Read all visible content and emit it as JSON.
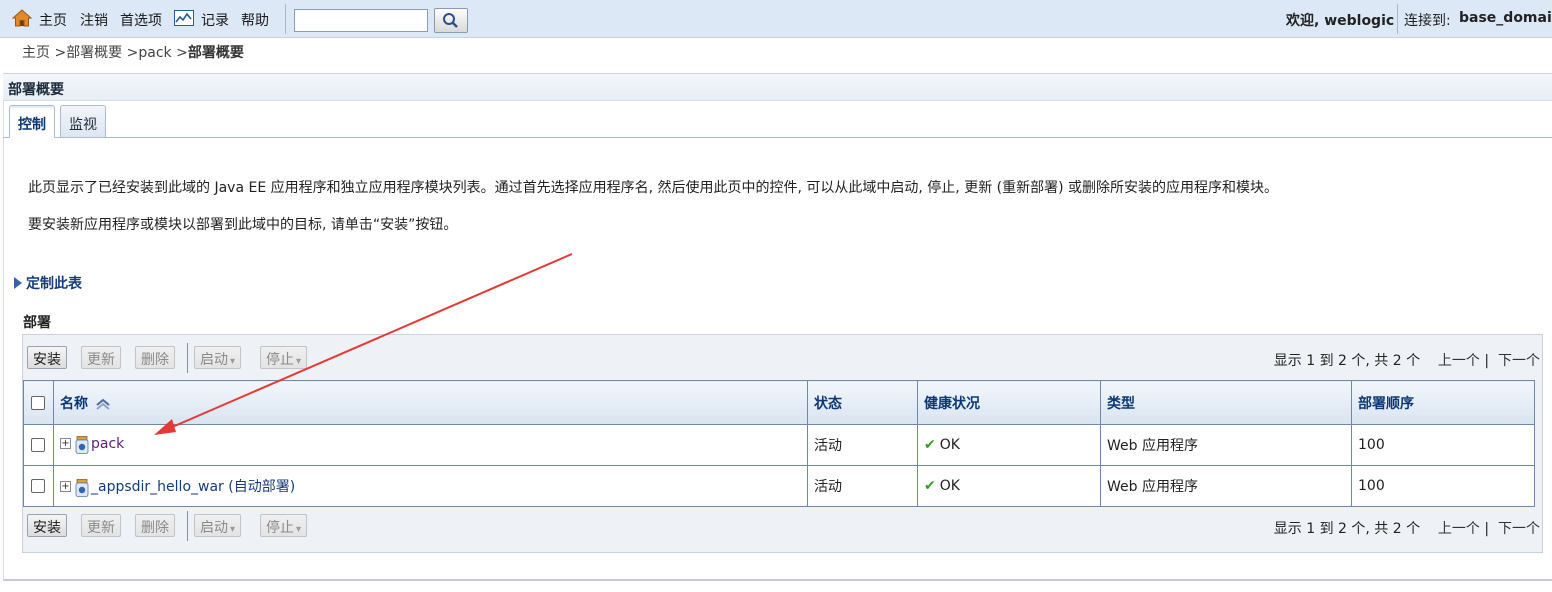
{
  "topbar": {
    "home": "主页",
    "logout": "注销",
    "preferences": "首选项",
    "record": "记录",
    "help": "帮助",
    "search_value": "",
    "welcome": "欢迎, weblogic",
    "connected_label": "连接到:",
    "domain": "base_domain"
  },
  "breadcrumb": {
    "home": "主页",
    "sep": ">",
    "deploy_overview": "部署概要",
    "pack": "pack",
    "current": "部署概要"
  },
  "panel": {
    "title": "部署概要",
    "tabs": [
      "控制",
      "监视"
    ],
    "desc1": "此页显示了已经安装到此域的 Java EE 应用程序和独立应用程序模块列表。通过首先选择应用程序名, 然后使用此页中的控件, 可以从此域中启动, 停止, 更新 (重新部署) 或删除所安装的应用程序和模块。",
    "desc2": "要安装新应用程序或模块以部署到此域中的目标, 请单击“安装”按钮。",
    "customize": "定制此表",
    "section": "部署"
  },
  "toolbar": {
    "install": "安装",
    "update": "更新",
    "delete": "删除",
    "start": "启动",
    "stop": "停止",
    "pager_text": "显示 1 到 2 个, 共 2 个",
    "prev": "上一个",
    "pager_sep": "|",
    "next": "下一个"
  },
  "table": {
    "headers": [
      "名称",
      "状态",
      "健康状况",
      "类型",
      "部署顺序"
    ],
    "rows": [
      {
        "name": "pack",
        "state": "活动",
        "health": "OK",
        "type": "Web 应用程序",
        "order": "100"
      },
      {
        "name": "_appsdir_hello_war (自动部署)",
        "state": "活动",
        "health": "OK",
        "type": "Web 应用程序",
        "order": "100"
      }
    ]
  },
  "colors": {
    "topbar_bg": "#dde8f6",
    "header_text": "#0c3874",
    "link_visited": "#5a1f7a",
    "annotation_arrow": "#e53935"
  }
}
